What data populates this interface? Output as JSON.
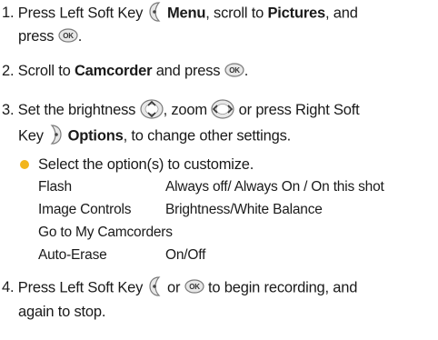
{
  "steps": [
    {
      "number": "1.",
      "l1_a": "Press Left Soft Key",
      "l1_b": "Menu",
      "l1_c": ", scroll to",
      "l1_d": "Pictures",
      "l1_e": ", and",
      "l2_a": "press",
      "l2_b": "."
    },
    {
      "number": "2.",
      "a": "Scroll to",
      "b": "Camcorder",
      "c": "and press",
      "d": "."
    },
    {
      "number": "3.",
      "l1_a": "Set the brightness",
      "l1_b": ", zoom",
      "l1_c": "or press Right Soft",
      "l2_a": "Key",
      "l2_b": "Options",
      "l2_c": ", to change other settings."
    },
    {
      "number": "4.",
      "l1_a": "Press Left Soft Key",
      "l1_b": "or",
      "l1_c": "to begin recording, and",
      "l2": "again to stop."
    }
  ],
  "bullet_text": "Select the option(s) to customize.",
  "options": [
    {
      "name": "Flash",
      "value": "Always off/ Always On / On this shot"
    },
    {
      "name": "Image Controls",
      "value": "Brightness/White Balance"
    },
    {
      "name": "Go to My Camcorders",
      "value": ""
    },
    {
      "name": "Auto-Erase",
      "value": "On/Off"
    }
  ],
  "icons": {
    "left_soft_key": "left-soft-key-icon",
    "right_soft_key": "right-soft-key-icon",
    "ok": "ok-key-icon",
    "nav_updown": "nav-up-down-icon",
    "nav_leftright": "nav-left-right-icon"
  },
  "colors": {
    "bullet": "#f2b51c",
    "key_outline": "#7a7a7a",
    "key_fill": "#e8e8e8"
  }
}
